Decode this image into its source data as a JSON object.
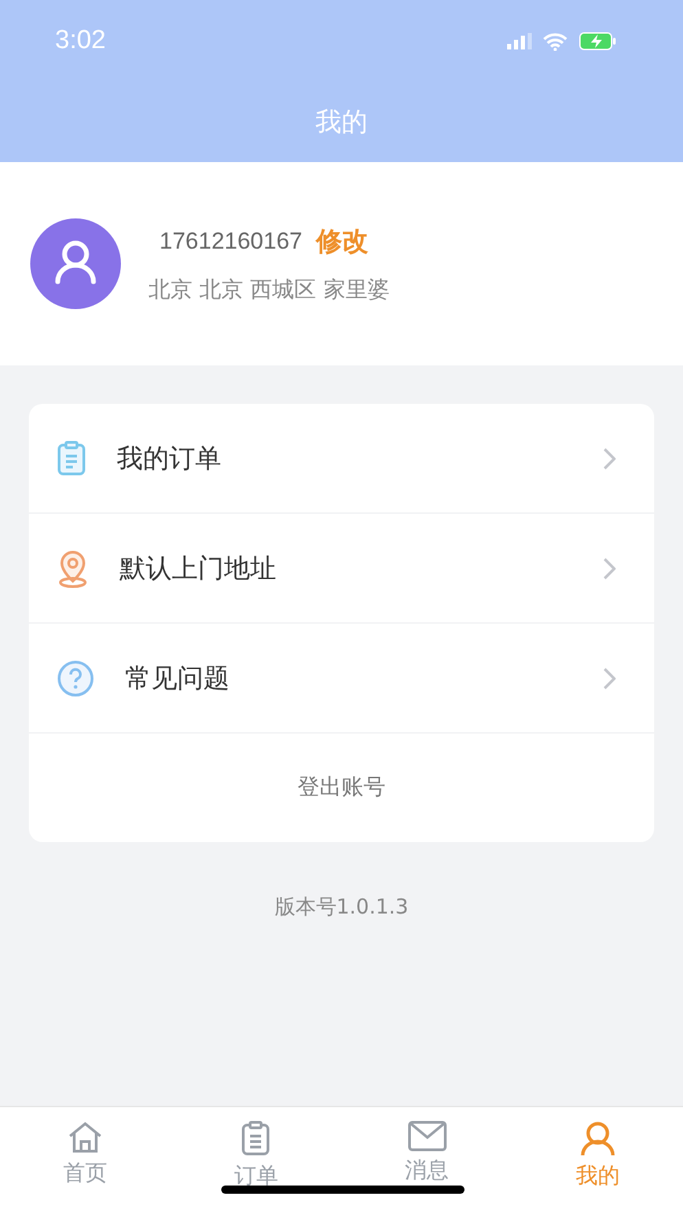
{
  "status_bar": {
    "time": "3:02"
  },
  "nav": {
    "title": "我的"
  },
  "profile": {
    "phone": "17612160167",
    "edit": "修改",
    "address": "北京 北京 西城区 家里婆"
  },
  "menu": [
    {
      "kind": "orders",
      "label": "我的订单"
    },
    {
      "kind": "address",
      "label": "默认上门地址"
    },
    {
      "kind": "faq",
      "label": "常见问题"
    }
  ],
  "logout": "登出账号",
  "version": "版本号1.0.1.3",
  "tabs": [
    {
      "kind": "home",
      "label": "首页",
      "selected": false
    },
    {
      "kind": "orders",
      "label": "订单",
      "selected": false
    },
    {
      "kind": "messages",
      "label": "消息",
      "selected": false
    },
    {
      "kind": "me",
      "label": "我的",
      "selected": true
    }
  ]
}
